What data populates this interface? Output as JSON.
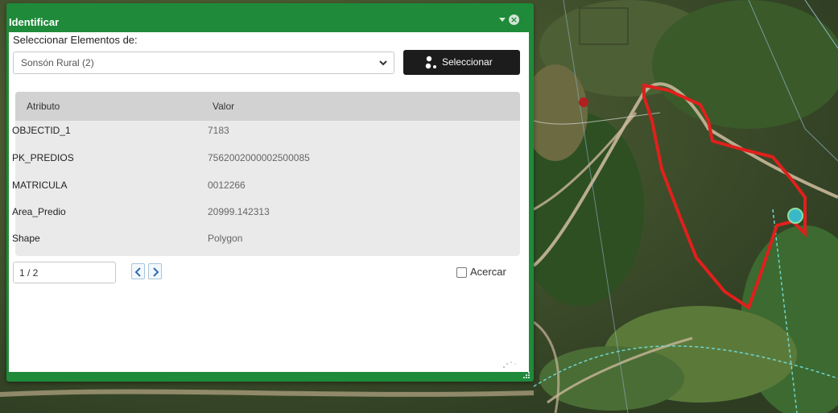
{
  "panel": {
    "title": "Identificar",
    "select_label": "Seleccionar Elementos de:",
    "select_value": "Sonsón Rural (2)",
    "select_button": "Seleccionar",
    "columns": [
      "Atributo",
      "Valor"
    ],
    "rows": [
      {
        "attr": "OBJECTID_1",
        "value": "7183"
      },
      {
        "attr": "PK_PREDIOS",
        "value": "7562002000002500085"
      },
      {
        "attr": "MATRICULA",
        "value": "0012266"
      },
      {
        "attr": "Area_Predio",
        "value": "20999.142313"
      },
      {
        "attr": "Shape",
        "value": "Polygon"
      }
    ],
    "pager": "1 / 2",
    "zoom_checkbox_label": "Acercar"
  },
  "colors": {
    "panel_green": "#1e8a3a",
    "parcel_outline": "#e0201c",
    "button_dark": "#1c1c1c"
  },
  "icons": [
    "collapse-icon",
    "close-icon",
    "chevron-down-icon",
    "select-features-icon",
    "prev-icon",
    "next-icon",
    "loading-spinner-icon",
    "resize-handle-icon",
    "map-pin-icon",
    "location-marker-icon"
  ]
}
